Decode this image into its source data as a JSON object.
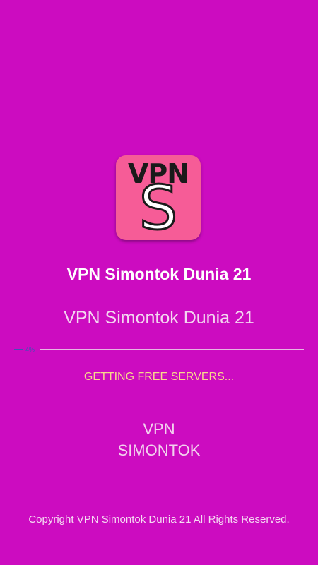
{
  "logo": {
    "top_text": "VPN",
    "letter": "S"
  },
  "app": {
    "title": "VPN Simontok Dunia 21",
    "subtitle": "VPN Simontok Dunia 21"
  },
  "progress": {
    "value_percent": 4,
    "label": "4%"
  },
  "status": {
    "text": "GETTING FREE SERVERS..."
  },
  "brand": {
    "line1": "VPN",
    "line2": "SIMONTOK"
  },
  "footer": {
    "copyright": "Copyright VPN Simontok Dunia 21 All Rights Reserved."
  },
  "colors": {
    "background": "#cc0cc0",
    "logo_background": "#f65c97",
    "progress_accent": "#3f51b5",
    "status_text": "#f8d88c"
  }
}
